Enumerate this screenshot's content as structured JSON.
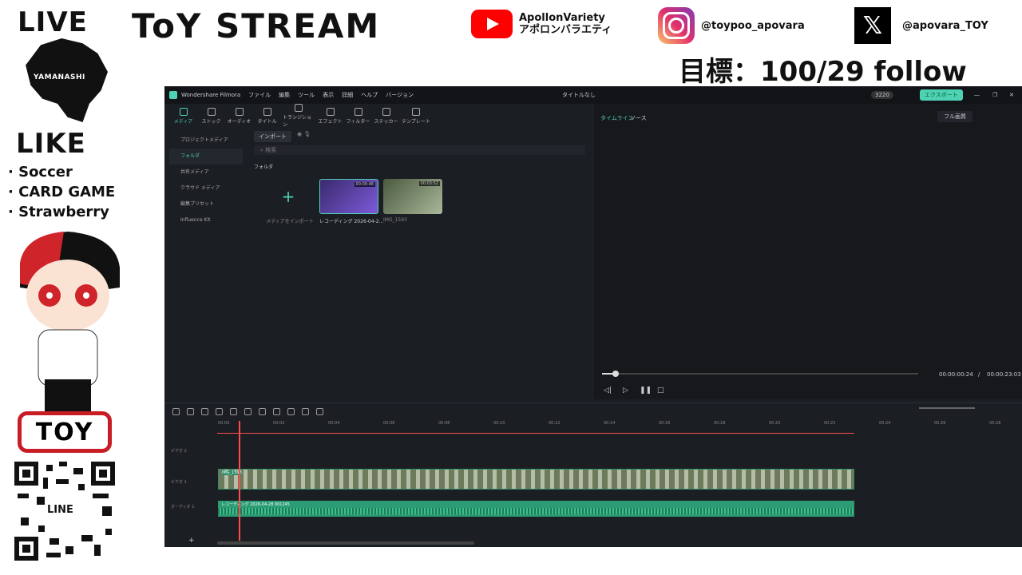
{
  "overlay": {
    "live": "LIVE",
    "stream_title": "ToY STREAM",
    "yamanashi": "YAMANASHI",
    "like": "LIKE",
    "topics": [
      "· Soccer",
      "· CARD GAME",
      "· Strawberry"
    ],
    "goal": "目標：100/29 follow",
    "youtube": {
      "line1": "ApollonVariety",
      "line2": "アポロンバラエティ"
    },
    "instagram": "@toypoo_apovara",
    "x": "@apovara_TOY",
    "toy_logo": "TOY",
    "line": "LINE"
  },
  "app": {
    "name": "Wondershare Filmora",
    "menus": [
      "ファイル",
      "編集",
      "ツール",
      "表示",
      "詳細",
      "ヘルプ",
      "バージョン"
    ],
    "doc_title": "タイトルなし",
    "credits": "3220",
    "export": "エクスポート",
    "toolbar": [
      "メディア",
      "ストック",
      "オーディオ",
      "タイトル",
      "トランジション",
      "エフェクト",
      "フィルター",
      "ステッカー",
      "テンプレート"
    ],
    "sidebar": [
      "プロジェクトメディア",
      "フォルダ",
      "共有メディア",
      "クラウド メディア",
      "編集プリセット",
      "Influence Kit"
    ],
    "import_label": "インポート",
    "search_placeholder": "検索",
    "folder_label": "フォルダ",
    "import_media": "メディアをインポート",
    "clips": [
      {
        "name": "レコーディング 2026-04-2...",
        "duration": "00:00:48"
      },
      {
        "name": "IMG_1593",
        "duration": "00:03:52"
      }
    ],
    "preview_tabs": [
      "タイムライン",
      "ソース"
    ],
    "quality": "フル画質",
    "time_current": "00:00:00:24",
    "time_total": "00:00:23:03",
    "time_sep": "/",
    "ruler": [
      "00:00",
      "00:02",
      "00:04",
      "00:06",
      "00:08",
      "00:10",
      "00:12",
      "00:14",
      "00:16",
      "00:18",
      "00:20",
      "00:22",
      "00:24",
      "00:26",
      "00:28"
    ],
    "tracks": [
      {
        "label": "ビデオ 2"
      },
      {
        "label": "ビデオ 1",
        "clip": "IMG_1593"
      },
      {
        "label": "オーディオ 1",
        "clip": "レコーディング 2026-04-28 001245"
      }
    ],
    "colors": {
      "accent": "#4fd1b5",
      "clip_video": "#2e8f6a",
      "clip_audio": "#2c9c74",
      "playhead": "#ff4d4f"
    }
  }
}
